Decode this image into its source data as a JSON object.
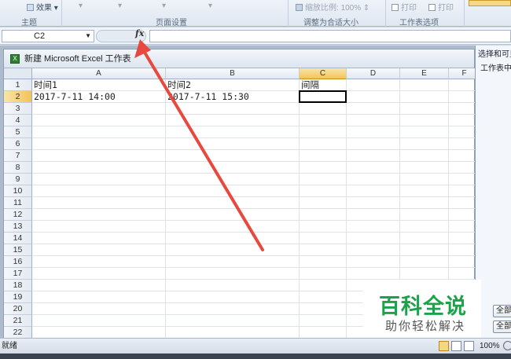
{
  "ribbon": {
    "effects_label": "效果",
    "theme_group": "主题",
    "page_setup_group": "页面设置",
    "scale_label": "缩放比例:",
    "scale_value": "100%",
    "fit_group": "调整为合适大小",
    "print1": "打印",
    "print2": "打印",
    "sheet_options_group": "工作表选项"
  },
  "formula_bar": {
    "name_box": "C2",
    "fx_symbol": "fx",
    "formula": ""
  },
  "workbook": {
    "title": "新建 Microsoft Excel 工作表",
    "icon": "excel-icon",
    "columns": [
      "A",
      "B",
      "C",
      "D",
      "E",
      "F"
    ],
    "selected_column": "C",
    "selected_row": "2",
    "active_cell": "C2",
    "rows": [
      {
        "num": "1",
        "A": "时间1",
        "B": "时间2",
        "C": "间隔"
      },
      {
        "num": "2",
        "A": "2017-7-11 14:00",
        "B": "2017-7-11 15:30",
        "C": ""
      },
      {
        "num": "3"
      },
      {
        "num": "4"
      },
      {
        "num": "5"
      },
      {
        "num": "6"
      },
      {
        "num": "7"
      },
      {
        "num": "8"
      },
      {
        "num": "9"
      },
      {
        "num": "10"
      },
      {
        "num": "11"
      },
      {
        "num": "12"
      },
      {
        "num": "13"
      },
      {
        "num": "14"
      },
      {
        "num": "15"
      },
      {
        "num": "16"
      },
      {
        "num": "17"
      },
      {
        "num": "18"
      },
      {
        "num": "19"
      },
      {
        "num": "20"
      },
      {
        "num": "21"
      },
      {
        "num": "22"
      }
    ]
  },
  "task_pane": {
    "title": "选择和可见",
    "subtitle": "工作表中",
    "button1": "全部",
    "button2": "全部"
  },
  "status_bar": {
    "ready": "就绪",
    "zoom": "100%"
  },
  "watermark": {
    "title": "百科全说",
    "subtitle": "助你轻松解决"
  },
  "colors": {
    "arrow": "#e8493f",
    "watermark_green": "#1aa34a",
    "selected_header": "#f2c35a"
  }
}
